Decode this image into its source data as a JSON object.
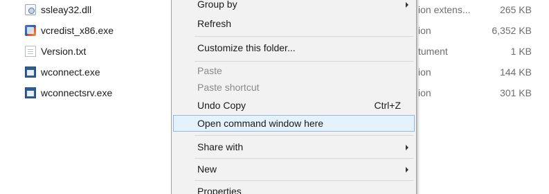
{
  "files": [
    {
      "name": "ssleay32.dll",
      "icon": "dll-file-icon",
      "type": "ion extens...",
      "size": "265 KB"
    },
    {
      "name": "vcredist_x86.exe",
      "icon": "setup-exe-icon",
      "type": "ion",
      "size": "6,352 KB"
    },
    {
      "name": "Version.txt",
      "icon": "text-file-icon",
      "type": "tument",
      "size": "1 KB"
    },
    {
      "name": "wconnect.exe",
      "icon": "exe-file-icon",
      "type": "ion",
      "size": "144 KB"
    },
    {
      "name": "wconnectsrv.exe",
      "icon": "exe-file-icon",
      "type": "ion",
      "size": "301 KB"
    }
  ],
  "context_menu": {
    "group_by": "Group by",
    "refresh": "Refresh",
    "customize_folder": "Customize this folder...",
    "paste": "Paste",
    "paste_shortcut": "Paste shortcut",
    "undo_copy": "Undo Copy",
    "undo_copy_shortcut": "Ctrl+Z",
    "open_command_window": "Open command window here",
    "share_with": "Share with",
    "new": "New",
    "properties": "Properties"
  },
  "colors": {
    "menu_background": "#f2f2f2",
    "highlight_background": "#e5f1fb",
    "highlight_border": "#8fb9e3",
    "disabled_text": "#8a8a8a"
  }
}
